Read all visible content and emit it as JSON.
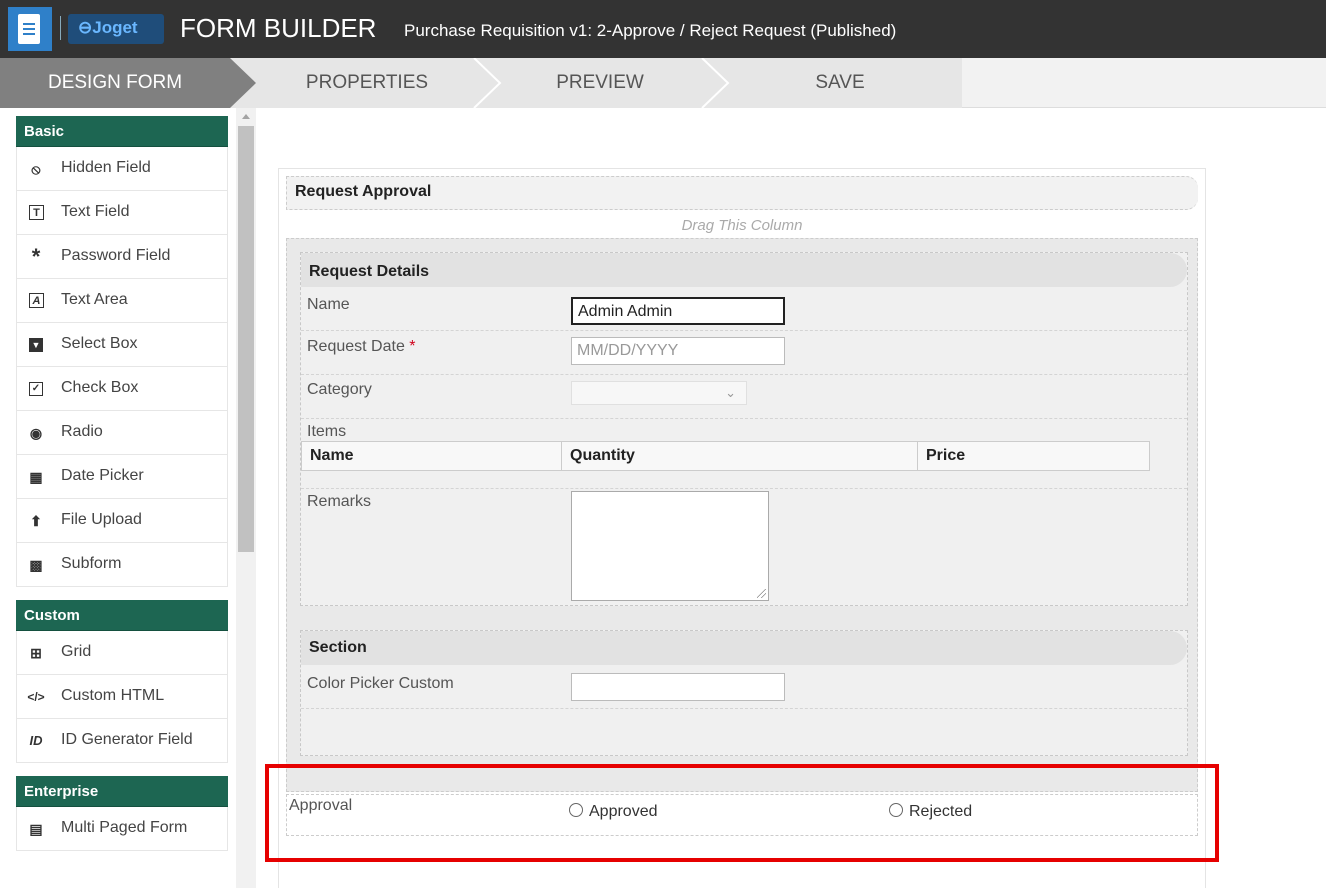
{
  "header": {
    "logo_text": "⊖Joget",
    "title": "FORM BUILDER",
    "subtitle": "Purchase Requisition v1: 2-Approve / Reject Request (Published)"
  },
  "steps": {
    "design": "DESIGN FORM",
    "properties": "PROPERTIES",
    "preview": "PREVIEW",
    "save": "SAVE"
  },
  "palette": {
    "basic": {
      "title": "Basic",
      "items": [
        {
          "label": "Hidden Field",
          "icon": "hidden-eye-icon"
        },
        {
          "label": "Text Field",
          "icon": "text-field-icon"
        },
        {
          "label": "Password Field",
          "icon": "asterisk-icon"
        },
        {
          "label": "Text Area",
          "icon": "text-area-icon"
        },
        {
          "label": "Select Box",
          "icon": "select-box-icon"
        },
        {
          "label": "Check Box",
          "icon": "checkbox-icon"
        },
        {
          "label": "Radio",
          "icon": "radio-icon"
        },
        {
          "label": "Date Picker",
          "icon": "calendar-icon"
        },
        {
          "label": "File Upload",
          "icon": "upload-icon"
        },
        {
          "label": "Subform",
          "icon": "subform-icon"
        }
      ]
    },
    "custom": {
      "title": "Custom",
      "items": [
        {
          "label": "Grid",
          "icon": "grid-icon"
        },
        {
          "label": "Custom HTML",
          "icon": "code-icon"
        },
        {
          "label": "ID Generator Field",
          "icon": "id-icon"
        }
      ]
    },
    "enterprise": {
      "title": "Enterprise",
      "items": [
        {
          "label": "Multi Paged Form",
          "icon": "multi-page-icon"
        }
      ]
    }
  },
  "form": {
    "section_title": "Request Approval",
    "drag_hint": "Drag This Column",
    "details": {
      "title": "Request Details",
      "name_label": "Name",
      "name_value": "Admin Admin",
      "date_label": "Request Date",
      "date_required": "*",
      "date_placeholder": "MM/DD/YYYY",
      "category_label": "Category",
      "items_label": "Items",
      "grid_columns": [
        "Name",
        "Quantity",
        "Price"
      ],
      "remarks_label": "Remarks"
    },
    "section2": {
      "title": "Section",
      "color_label": "Color Picker Custom"
    },
    "approval": {
      "label": "Approval",
      "options": [
        "Approved",
        "Rejected"
      ]
    }
  },
  "colors": {
    "palette_header": "#1d6652",
    "highlight": "#e60000",
    "topbar": "#333333"
  }
}
